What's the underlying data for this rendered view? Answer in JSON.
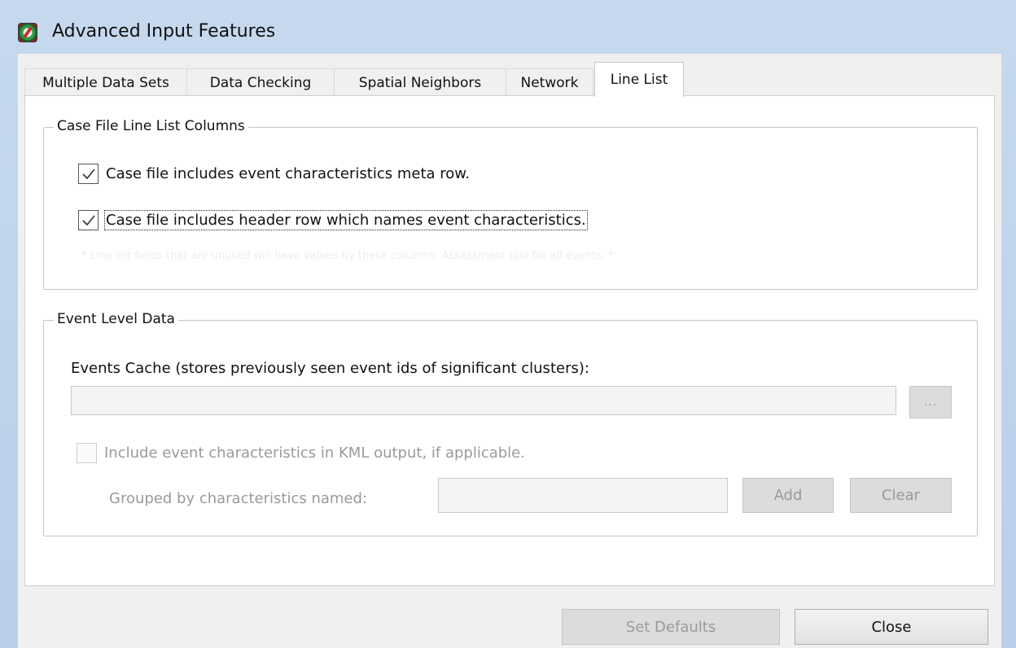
{
  "window": {
    "title": "Advanced Input Features",
    "icon": "satscan-app-icon"
  },
  "tabs": [
    {
      "label": "Multiple Data Sets",
      "active": false
    },
    {
      "label": "Data Checking",
      "active": false
    },
    {
      "label": "Spatial Neighbors",
      "active": false
    },
    {
      "label": "Network",
      "active": false
    },
    {
      "label": "Line List",
      "active": true
    }
  ],
  "case_file_group": {
    "title": "Case File Line List Columns",
    "meta_row": {
      "label": "Case file includes event characteristics meta row.",
      "checked": true
    },
    "header_row": {
      "label": "Case file includes header row which names event characteristics.",
      "checked": true
    },
    "hint": "* Line list fields that are unused will have values by these columns. Assessment tool for all events. *"
  },
  "event_group": {
    "title": "Event Level Data",
    "cache_label": "Events Cache (stores previously seen event ids of significant clusters):",
    "cache_value": "",
    "browse_label": "...",
    "kml": {
      "label": "Include event characteristics in KML output, if applicable.",
      "checked": false
    },
    "grouped_label": "Grouped by characteristics named:",
    "grouped_value": "",
    "add_label": "Add",
    "clear_label": "Clear"
  },
  "footer": {
    "set_defaults_label": "Set Defaults",
    "close_label": "Close"
  },
  "colors": {
    "title_bar": "#c6d9ee",
    "client": "#f0f0f0",
    "panel": "#ffffff",
    "disabled_text": "#9a9a9a"
  }
}
